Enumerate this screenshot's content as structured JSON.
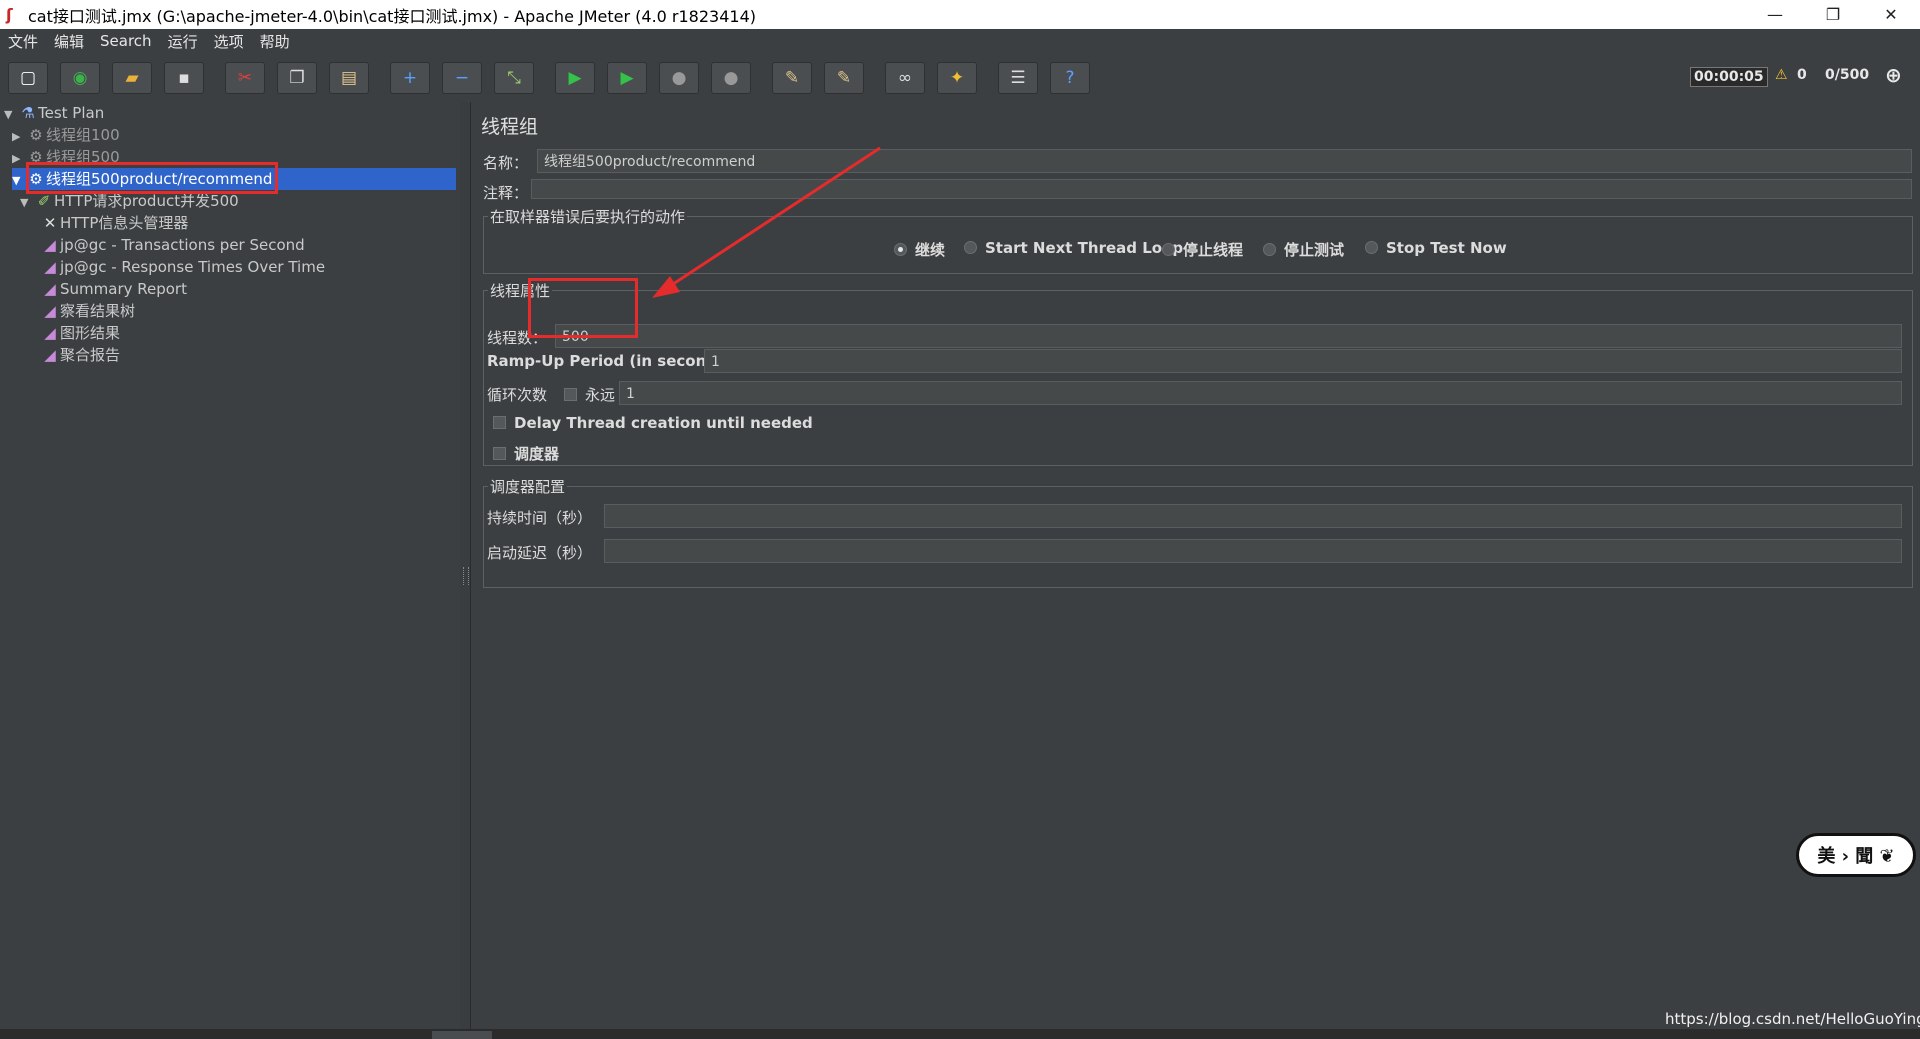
{
  "window": {
    "title": "cat接口测试.jmx (G:\\apache-jmeter-4.0\\bin\\cat接口测试.jmx) - Apache JMeter (4.0 r1823414)",
    "minimize": "—",
    "maximize": "❐",
    "close": "✕"
  },
  "menu": [
    "文件",
    "编辑",
    "Search",
    "运行",
    "选项",
    "帮助"
  ],
  "toolbar": {
    "timer": "00:00:05",
    "warnings": "0",
    "threads": "0/500"
  },
  "tree": {
    "items": [
      {
        "label": "Test Plan",
        "icon": "test-plan-icon"
      },
      {
        "label": "线程组100",
        "icon": "thread-group-gear-icon"
      },
      {
        "label": "线程组500",
        "icon": "thread-group-gear-icon"
      },
      {
        "label": "线程组500product/recommend",
        "icon": "thread-group-gear-icon"
      },
      {
        "label": "HTTP请求product并发500",
        "icon": "sampler-pen-icon"
      },
      {
        "label": "HTTP信息头管理器",
        "icon": "config-tools-icon"
      },
      {
        "label": "jp@gc - Transactions per Second",
        "icon": "listener-chart-icon"
      },
      {
        "label": "jp@gc - Response Times Over Time",
        "icon": "listener-chart-icon"
      },
      {
        "label": "Summary Report",
        "icon": "listener-chart-icon"
      },
      {
        "label": "察看结果树",
        "icon": "listener-chart-icon"
      },
      {
        "label": "图形结果",
        "icon": "listener-chart-icon"
      },
      {
        "label": "聚合报告",
        "icon": "listener-chart-icon"
      }
    ]
  },
  "panel": {
    "title": "线程组",
    "name_label": "名称：",
    "name_value": "线程组500product/recommend",
    "comment_label": "注释：",
    "comment_value": "",
    "error_group_label": "在取样器错误后要执行的动作",
    "error_actions": [
      {
        "label": "继续",
        "selected": true
      },
      {
        "label": "Start Next Thread Loop",
        "selected": false
      },
      {
        "label": "停止线程",
        "selected": false
      },
      {
        "label": "停止测试",
        "selected": false
      },
      {
        "label": "Stop Test Now",
        "selected": false
      }
    ],
    "thread_group_label": "线程属性",
    "threads_label": "线程数：",
    "threads_value": "500",
    "rampup_label": "Ramp-Up Period (in seconds):",
    "rampup_value": "1",
    "loop_label": "循环次数",
    "forever_label": "永远",
    "loop_value": "1",
    "delay_label": "Delay Thread creation until needed",
    "scheduler_label": "调度器",
    "scheduler_group_label": "调度器配置",
    "duration_label": "持续时间（秒）",
    "duration_value": "",
    "startup_delay_label": "启动延迟（秒）",
    "startup_delay_value": ""
  },
  "overlay": {
    "watermark": "https://blog.csdn.net/HelloGuoYing",
    "sticker": "美 › 聞 ❦",
    "annotation_color": "#e52b2b"
  }
}
